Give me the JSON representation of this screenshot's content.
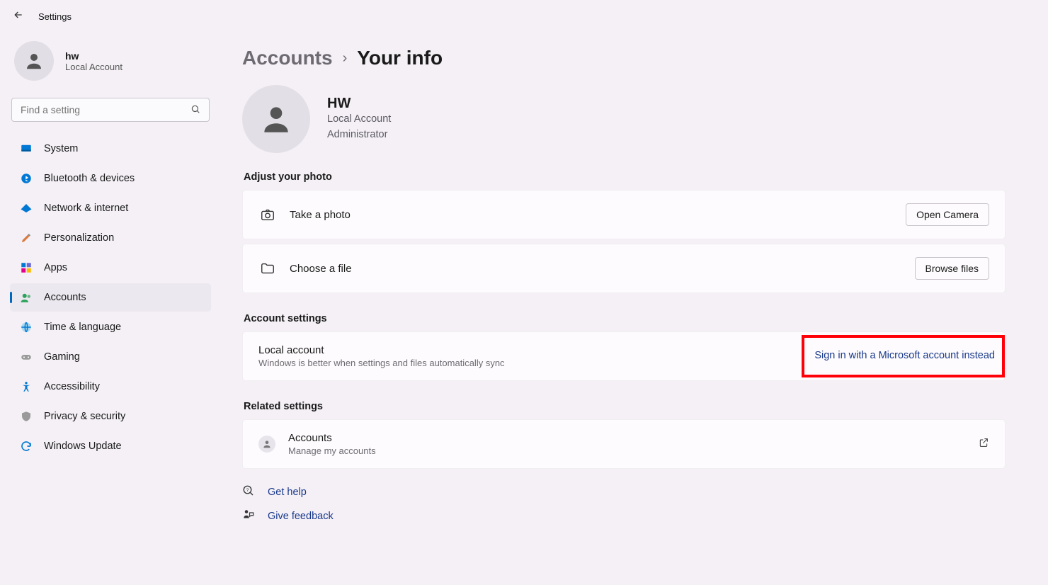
{
  "window": {
    "title": "Settings"
  },
  "sidebar": {
    "user": {
      "name": "hw",
      "subtitle": "Local Account"
    },
    "search_placeholder": "Find a setting",
    "items": [
      {
        "label": "System"
      },
      {
        "label": "Bluetooth & devices"
      },
      {
        "label": "Network & internet"
      },
      {
        "label": "Personalization"
      },
      {
        "label": "Apps"
      },
      {
        "label": "Accounts"
      },
      {
        "label": "Time & language"
      },
      {
        "label": "Gaming"
      },
      {
        "label": "Accessibility"
      },
      {
        "label": "Privacy & security"
      },
      {
        "label": "Windows Update"
      }
    ]
  },
  "breadcrumb": {
    "parent": "Accounts",
    "current": "Your info"
  },
  "profile": {
    "name": "HW",
    "line1": "Local Account",
    "line2": "Administrator"
  },
  "sections": {
    "photo": {
      "heading": "Adjust your photo",
      "take": {
        "label": "Take a photo",
        "button": "Open Camera"
      },
      "choose": {
        "label": "Choose a file",
        "button": "Browse files"
      }
    },
    "account": {
      "heading": "Account settings",
      "local": {
        "title": "Local account",
        "subtitle": "Windows is better when settings and files automatically sync",
        "link": "Sign in with a Microsoft account instead"
      }
    },
    "related": {
      "heading": "Related settings",
      "accounts": {
        "title": "Accounts",
        "subtitle": "Manage my accounts"
      }
    }
  },
  "footer": {
    "help": "Get help",
    "feedback": "Give feedback"
  }
}
